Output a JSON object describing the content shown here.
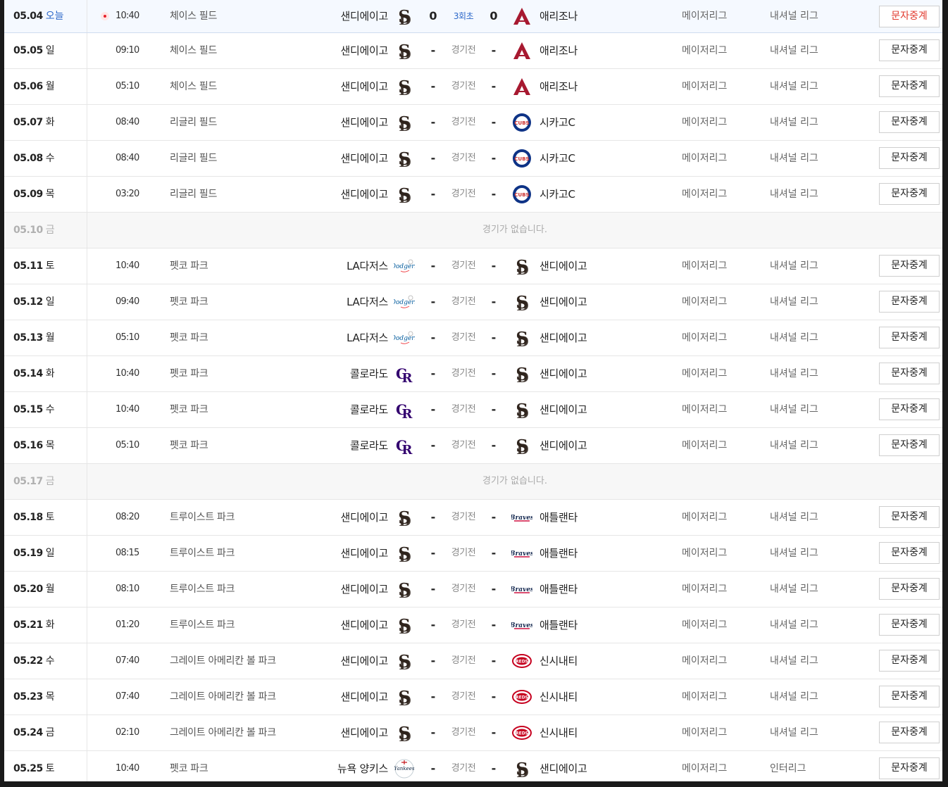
{
  "schedule": {
    "button_label": "문자중계",
    "today_label": "오늘",
    "no_game_text": "경기가 없습니다.",
    "rows": [
      {
        "date": "05.04",
        "dow": "",
        "today": true,
        "time": "10:40",
        "stadium": "체이스 필드",
        "home": "샌디에이고",
        "home_logo": "padres",
        "score1": "0",
        "status": "3회초",
        "score2": "0",
        "away": "애리조나",
        "away_logo": "dbacks",
        "league": "메이저리그",
        "division": "내셔널 리그"
      },
      {
        "date": "05.05",
        "dow": "일",
        "time": "09:10",
        "stadium": "체이스 필드",
        "home": "샌디에이고",
        "home_logo": "padres",
        "score1": "-",
        "status": "경기전",
        "score2": "-",
        "away": "애리조나",
        "away_logo": "dbacks",
        "league": "메이저리그",
        "division": "내셔널 리그"
      },
      {
        "date": "05.06",
        "dow": "월",
        "time": "05:10",
        "stadium": "체이스 필드",
        "home": "샌디에이고",
        "home_logo": "padres",
        "score1": "-",
        "status": "경기전",
        "score2": "-",
        "away": "애리조나",
        "away_logo": "dbacks",
        "league": "메이저리그",
        "division": "내셔널 리그"
      },
      {
        "date": "05.07",
        "dow": "화",
        "time": "08:40",
        "stadium": "리글리 필드",
        "home": "샌디에이고",
        "home_logo": "padres",
        "score1": "-",
        "status": "경기전",
        "score2": "-",
        "away": "시카고C",
        "away_logo": "cubs",
        "league": "메이저리그",
        "division": "내셔널 리그"
      },
      {
        "date": "05.08",
        "dow": "수",
        "time": "08:40",
        "stadium": "리글리 필드",
        "home": "샌디에이고",
        "home_logo": "padres",
        "score1": "-",
        "status": "경기전",
        "score2": "-",
        "away": "시카고C",
        "away_logo": "cubs",
        "league": "메이저리그",
        "division": "내셔널 리그"
      },
      {
        "date": "05.09",
        "dow": "목",
        "time": "03:20",
        "stadium": "리글리 필드",
        "home": "샌디에이고",
        "home_logo": "padres",
        "score1": "-",
        "status": "경기전",
        "score2": "-",
        "away": "시카고C",
        "away_logo": "cubs",
        "league": "메이저리그",
        "division": "내셔널 리그"
      },
      {
        "date": "05.10",
        "dow": "금",
        "nogame": true
      },
      {
        "date": "05.11",
        "dow": "토",
        "time": "10:40",
        "stadium": "펫코 파크",
        "home": "LA다저스",
        "home_logo": "dodgers",
        "score1": "-",
        "status": "경기전",
        "score2": "-",
        "away": "샌디에이고",
        "away_logo": "padres",
        "league": "메이저리그",
        "division": "내셔널 리그"
      },
      {
        "date": "05.12",
        "dow": "일",
        "time": "09:40",
        "stadium": "펫코 파크",
        "home": "LA다저스",
        "home_logo": "dodgers",
        "score1": "-",
        "status": "경기전",
        "score2": "-",
        "away": "샌디에이고",
        "away_logo": "padres",
        "league": "메이저리그",
        "division": "내셔널 리그"
      },
      {
        "date": "05.13",
        "dow": "월",
        "time": "05:10",
        "stadium": "펫코 파크",
        "home": "LA다저스",
        "home_logo": "dodgers",
        "score1": "-",
        "status": "경기전",
        "score2": "-",
        "away": "샌디에이고",
        "away_logo": "padres",
        "league": "메이저리그",
        "division": "내셔널 리그"
      },
      {
        "date": "05.14",
        "dow": "화",
        "time": "10:40",
        "stadium": "펫코 파크",
        "home": "콜로라도",
        "home_logo": "rockies",
        "score1": "-",
        "status": "경기전",
        "score2": "-",
        "away": "샌디에이고",
        "away_logo": "padres",
        "league": "메이저리그",
        "division": "내셔널 리그"
      },
      {
        "date": "05.15",
        "dow": "수",
        "time": "10:40",
        "stadium": "펫코 파크",
        "home": "콜로라도",
        "home_logo": "rockies",
        "score1": "-",
        "status": "경기전",
        "score2": "-",
        "away": "샌디에이고",
        "away_logo": "padres",
        "league": "메이저리그",
        "division": "내셔널 리그"
      },
      {
        "date": "05.16",
        "dow": "목",
        "time": "05:10",
        "stadium": "펫코 파크",
        "home": "콜로라도",
        "home_logo": "rockies",
        "score1": "-",
        "status": "경기전",
        "score2": "-",
        "away": "샌디에이고",
        "away_logo": "padres",
        "league": "메이저리그",
        "division": "내셔널 리그"
      },
      {
        "date": "05.17",
        "dow": "금",
        "nogame": true
      },
      {
        "date": "05.18",
        "dow": "토",
        "time": "08:20",
        "stadium": "트루이스트 파크",
        "home": "샌디에이고",
        "home_logo": "padres",
        "score1": "-",
        "status": "경기전",
        "score2": "-",
        "away": "애틀랜타",
        "away_logo": "braves",
        "league": "메이저리그",
        "division": "내셔널 리그"
      },
      {
        "date": "05.19",
        "dow": "일",
        "time": "08:15",
        "stadium": "트루이스트 파크",
        "home": "샌디에이고",
        "home_logo": "padres",
        "score1": "-",
        "status": "경기전",
        "score2": "-",
        "away": "애틀랜타",
        "away_logo": "braves",
        "league": "메이저리그",
        "division": "내셔널 리그"
      },
      {
        "date": "05.20",
        "dow": "월",
        "time": "08:10",
        "stadium": "트루이스트 파크",
        "home": "샌디에이고",
        "home_logo": "padres",
        "score1": "-",
        "status": "경기전",
        "score2": "-",
        "away": "애틀랜타",
        "away_logo": "braves",
        "league": "메이저리그",
        "division": "내셔널 리그"
      },
      {
        "date": "05.21",
        "dow": "화",
        "time": "01:20",
        "stadium": "트루이스트 파크",
        "home": "샌디에이고",
        "home_logo": "padres",
        "score1": "-",
        "status": "경기전",
        "score2": "-",
        "away": "애틀랜타",
        "away_logo": "braves",
        "league": "메이저리그",
        "division": "내셔널 리그"
      },
      {
        "date": "05.22",
        "dow": "수",
        "time": "07:40",
        "stadium": "그레이트 아메리칸 볼 파크",
        "home": "샌디에이고",
        "home_logo": "padres",
        "score1": "-",
        "status": "경기전",
        "score2": "-",
        "away": "신시내티",
        "away_logo": "reds",
        "league": "메이저리그",
        "division": "내셔널 리그"
      },
      {
        "date": "05.23",
        "dow": "목",
        "time": "07:40",
        "stadium": "그레이트 아메리칸 볼 파크",
        "home": "샌디에이고",
        "home_logo": "padres",
        "score1": "-",
        "status": "경기전",
        "score2": "-",
        "away": "신시내티",
        "away_logo": "reds",
        "league": "메이저리그",
        "division": "내셔널 리그"
      },
      {
        "date": "05.24",
        "dow": "금",
        "time": "02:10",
        "stadium": "그레이트 아메리칸 볼 파크",
        "home": "샌디에이고",
        "home_logo": "padres",
        "score1": "-",
        "status": "경기전",
        "score2": "-",
        "away": "신시내티",
        "away_logo": "reds",
        "league": "메이저리그",
        "division": "내셔널 리그"
      },
      {
        "date": "05.25",
        "dow": "토",
        "time": "10:40",
        "stadium": "펫코 파크",
        "home": "뉴욕 양키스",
        "home_logo": "yankees",
        "score1": "-",
        "status": "경기전",
        "score2": "-",
        "away": "샌디에이고",
        "away_logo": "padres",
        "league": "메이저리그",
        "division": "인터리그"
      }
    ]
  }
}
